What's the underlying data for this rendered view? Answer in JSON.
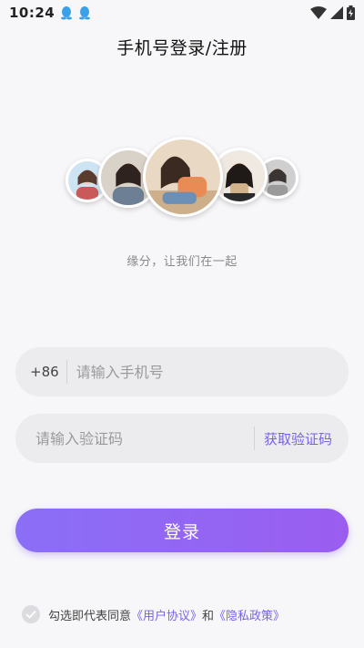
{
  "status_bar": {
    "time": "10:24",
    "icons": [
      "qq-icon",
      "qq-icon",
      "wifi-icon",
      "signal-icon",
      "battery-charging-icon"
    ]
  },
  "page": {
    "title": "手机号登录/注册",
    "slogan": "缘分，让我们在一起"
  },
  "avatars": [
    {
      "name": "avatar-1"
    },
    {
      "name": "avatar-2"
    },
    {
      "name": "avatar-3"
    },
    {
      "name": "avatar-4"
    },
    {
      "name": "avatar-5"
    }
  ],
  "form": {
    "country_code": "+86",
    "phone_placeholder": "请输入手机号",
    "phone_value": "",
    "code_placeholder": "请输入验证码",
    "code_value": "",
    "get_code_label": "获取验证码",
    "login_label": "登录"
  },
  "agreement": {
    "checked": false,
    "prefix": "勾选即代表同意",
    "user_agreement": "《用户协议》",
    "and": "和",
    "privacy_policy": "《隐私政策》"
  },
  "colors": {
    "accent": "#7a62e8",
    "button_start": "#8b6ff6",
    "button_end": "#9a5df0",
    "background": "#f7f7f9",
    "input_bg": "#ececee"
  }
}
